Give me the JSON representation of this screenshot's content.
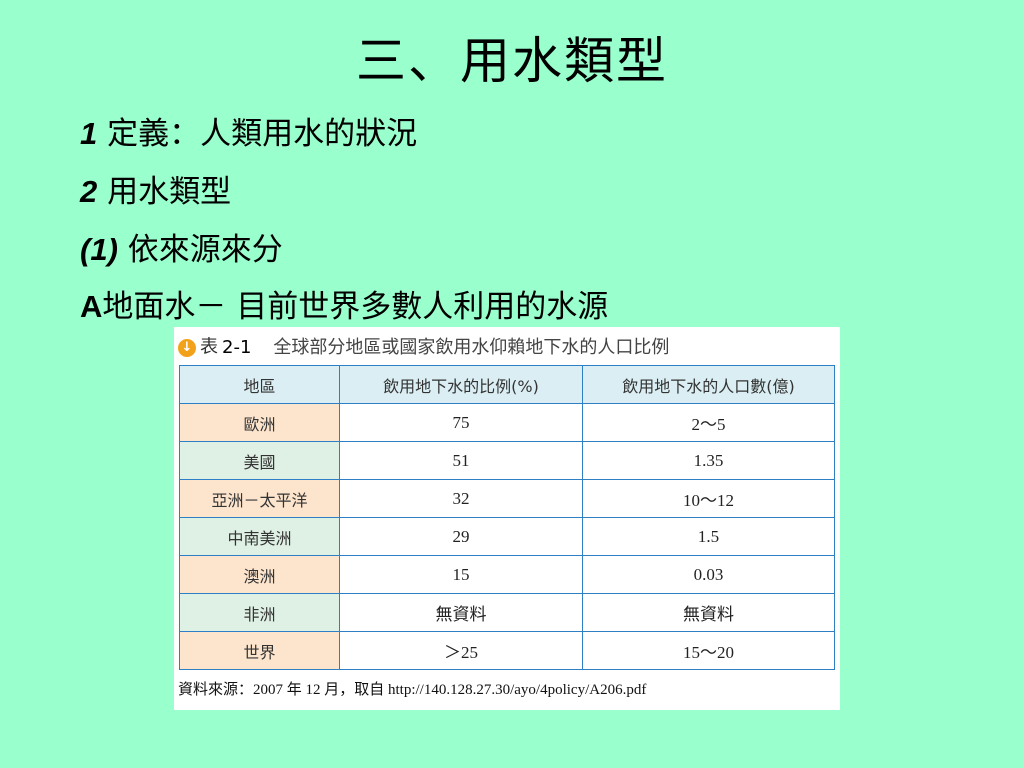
{
  "slide": {
    "title": "三、用水類型",
    "bullets": [
      {
        "num": "1",
        "text": " 定義：人類用水的狀況"
      },
      {
        "num": "2",
        "text": " 用水類型"
      },
      {
        "num": "(1)",
        "text": " 依來源來分"
      },
      {
        "lead": "A",
        "text": "地面水－ 目前世界多數人利用的水源"
      }
    ]
  },
  "figure": {
    "icon": "down-arrow-circle-icon",
    "caption_tag": "表",
    "caption_number": "2-1",
    "caption_title": "全球部分地區或國家飲用水仰賴地下水的人口比例",
    "table": {
      "headers": [
        "地區",
        "飲用地下水的比例(%)",
        "飲用地下水的人口數(億)"
      ],
      "rows": [
        [
          "歐洲",
          "75",
          "2～5"
        ],
        [
          "美國",
          "51",
          "1.35"
        ],
        [
          "亞洲－太平洋",
          "32",
          "10～12"
        ],
        [
          "中南美洲",
          "29",
          "1.5"
        ],
        [
          "澳洲",
          "15",
          "0.03"
        ],
        [
          "非洲",
          "無資料",
          "無資料"
        ],
        [
          "世界",
          "＞25",
          "15～20"
        ]
      ]
    },
    "source": "資料來源：2007 年 12 月，取自 http://140.128.27.30/ayo/4policy/A206.pdf"
  },
  "colors": {
    "background": "#99ffcc",
    "table_border": "#2e7fc4",
    "header_fill": "#daeef3",
    "region_fill_alt1": "#fde4cc",
    "region_fill_alt2": "#dff0e4",
    "icon_fill": "#f2a21a"
  }
}
